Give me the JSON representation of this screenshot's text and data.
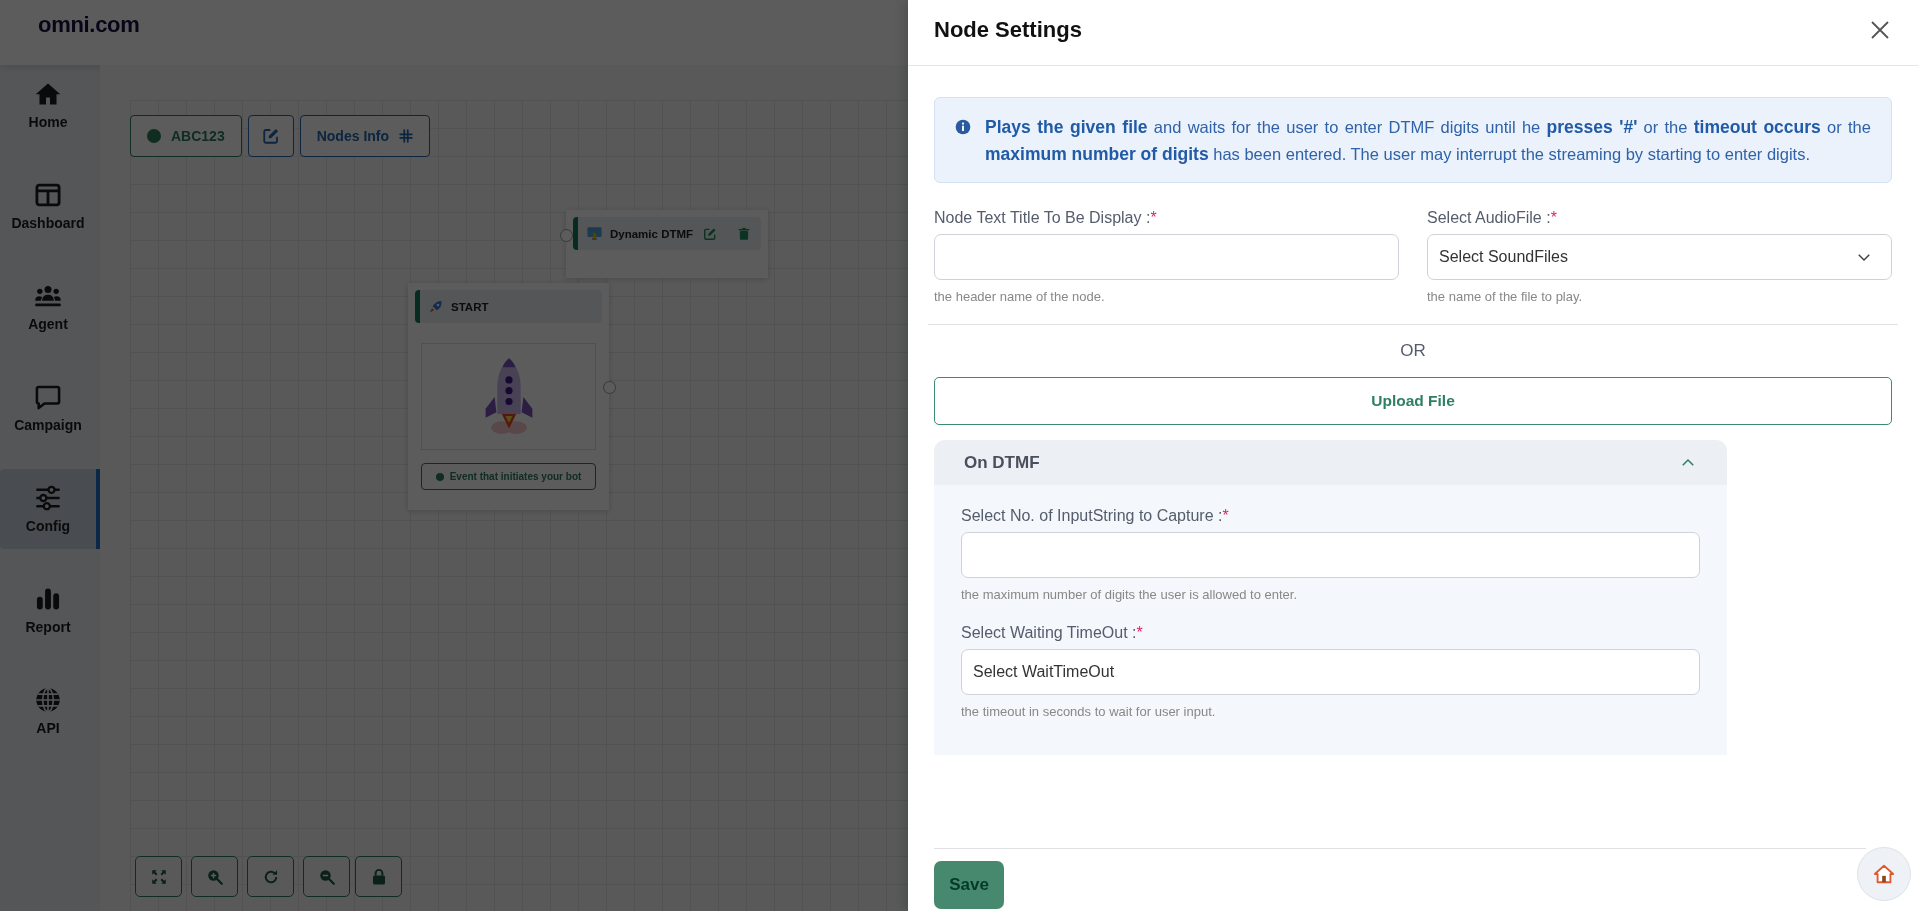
{
  "brand": "omni.com",
  "sidebar": {
    "items": [
      {
        "label": "Home",
        "selected": false
      },
      {
        "label": "Dashboard",
        "selected": false
      },
      {
        "label": "Agent",
        "selected": false
      },
      {
        "label": "Campaign",
        "selected": false
      },
      {
        "label": "Config",
        "selected": true
      },
      {
        "label": "Report",
        "selected": false
      },
      {
        "label": "API",
        "selected": false
      }
    ]
  },
  "canvas": {
    "flow_name": "ABC123",
    "info_button": "Nodes Info",
    "nodes": [
      {
        "kind": "action",
        "title": "Dynamic DTMF"
      },
      {
        "kind": "start",
        "title": "START",
        "event": "Event that initiates your bot"
      }
    ]
  },
  "panel": {
    "title": "Node Settings",
    "info": "**Plays the given file** and waits for the user to enter DTMF digits until he **presses '#'** or the **timeout occurs** or the **maximum number of digits** has been entered. The user may interrupt the streaming by starting to enter digits.",
    "fields": [
      {
        "kind": "text",
        "label": "Node Text Title To Be Display :",
        "mark": "*",
        "hint": "the header name of the node."
      },
      {
        "kind": "select",
        "label": "Select AudioFile :",
        "mark": "*",
        "value": "Select SoundFiles",
        "hint": "the name of the file to play."
      }
    ],
    "separator": "OR",
    "upload": "Upload File",
    "accordion": {
      "title": "On DTMF",
      "expanded": true,
      "fields": [
        {
          "kind": "text",
          "label": "Select No. of InputString to Capture :",
          "mark": "*",
          "hint": "the maximum number of digits the user is allowed to enter."
        },
        {
          "kind": "plain",
          "label": "Select Waiting TimeOut :",
          "mark": "*",
          "value": "Select WaitTimeOut",
          "hint": "the timeout in seconds to wait for user input."
        }
      ]
    },
    "save": "Save"
  }
}
